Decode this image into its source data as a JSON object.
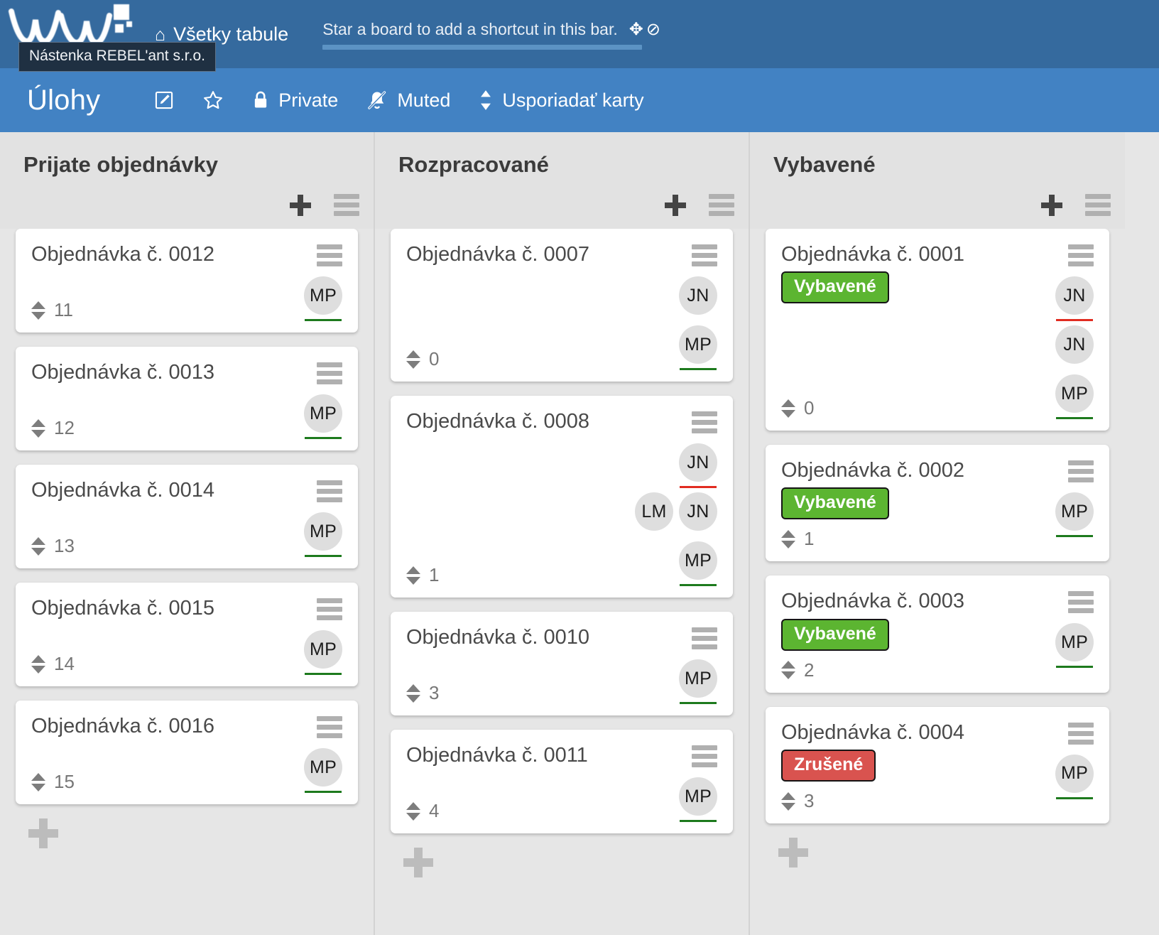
{
  "topbar": {
    "logo_tooltip": "Nástenka REBEL'ant s.r.o.",
    "all_boards_label": "Všetky tabule",
    "home_icon": "⌂",
    "shortcut_message": "Star a board to add a shortcut in this bar.",
    "move_icon": "✥",
    "block_icon": "⊘"
  },
  "boardbar": {
    "title": "Úlohy",
    "edit_icon": "✎",
    "star_icon": "☆",
    "visibility_label": "Private",
    "lock_icon": "ὑ2",
    "mute_label": "Muted",
    "sort_label": "Usporiadať karty"
  },
  "colors": {
    "topbar": "#356a9e",
    "boardbar": "#4282c3",
    "badge_green": "#5cb531",
    "badge_red": "#d9534f",
    "avatar_green": "#1d7a1d",
    "avatar_red": "#e12c21"
  },
  "columns": [
    {
      "title": "Prijate objednávky",
      "cards": [
        {
          "title": "Objednávka č. 0012",
          "badge": null,
          "count": "11",
          "avatars": [
            [
              {
                "initials": "MP",
                "underline": "green"
              }
            ]
          ]
        },
        {
          "title": "Objednávka č. 0013",
          "badge": null,
          "count": "12",
          "avatars": [
            [
              {
                "initials": "MP",
                "underline": "green"
              }
            ]
          ]
        },
        {
          "title": "Objednávka č. 0014",
          "badge": null,
          "count": "13",
          "avatars": [
            [
              {
                "initials": "MP",
                "underline": "green"
              }
            ]
          ]
        },
        {
          "title": "Objednávka č. 0015",
          "badge": null,
          "count": "14",
          "avatars": [
            [
              {
                "initials": "MP",
                "underline": "green"
              }
            ]
          ]
        },
        {
          "title": "Objednávka č. 0016",
          "badge": null,
          "count": "15",
          "avatars": [
            [
              {
                "initials": "MP",
                "underline": "green"
              }
            ]
          ]
        }
      ]
    },
    {
      "title": "Rozpracované",
      "cards": [
        {
          "title": "Objednávka č. 0007",
          "badge": null,
          "count": "0",
          "avatars": [
            [
              {
                "initials": "JN",
                "underline": "none"
              }
            ],
            [
              {
                "initials": "MP",
                "underline": "green"
              }
            ]
          ]
        },
        {
          "title": "Objednávka č. 0008",
          "badge": null,
          "count": "1",
          "avatars": [
            [
              {
                "initials": "JN",
                "underline": "red"
              }
            ],
            [
              {
                "initials": "LM",
                "underline": "none"
              },
              {
                "initials": "JN",
                "underline": "none"
              }
            ],
            [
              {
                "initials": "MP",
                "underline": "green"
              }
            ]
          ]
        },
        {
          "title": "Objednávka č. 0010",
          "badge": null,
          "count": "3",
          "avatars": [
            [
              {
                "initials": "MP",
                "underline": "green"
              }
            ]
          ]
        },
        {
          "title": "Objednávka č. 0011",
          "badge": null,
          "count": "4",
          "avatars": [
            [
              {
                "initials": "MP",
                "underline": "green"
              }
            ]
          ]
        }
      ]
    },
    {
      "title": "Vybavené",
      "cards": [
        {
          "title": "Objednávka č. 0001",
          "badge": {
            "label": "Vybavené",
            "kind": "green"
          },
          "count": "0",
          "avatars": [
            [
              {
                "initials": "JN",
                "underline": "red"
              }
            ],
            [
              {
                "initials": "JN",
                "underline": "none"
              }
            ],
            [
              {
                "initials": "MP",
                "underline": "green"
              }
            ]
          ]
        },
        {
          "title": "Objednávka č. 0002",
          "badge": {
            "label": "Vybavené",
            "kind": "green"
          },
          "count": "1",
          "avatars": [
            [
              {
                "initials": "MP",
                "underline": "green"
              }
            ]
          ]
        },
        {
          "title": "Objednávka č. 0003",
          "badge": {
            "label": "Vybavené",
            "kind": "green"
          },
          "count": "2",
          "avatars": [
            [
              {
                "initials": "MP",
                "underline": "green"
              }
            ]
          ]
        },
        {
          "title": "Objednávka č. 0004",
          "badge": {
            "label": "Zrušené",
            "kind": "red"
          },
          "count": "3",
          "avatars": [
            [
              {
                "initials": "MP",
                "underline": "green"
              }
            ]
          ]
        }
      ]
    }
  ]
}
